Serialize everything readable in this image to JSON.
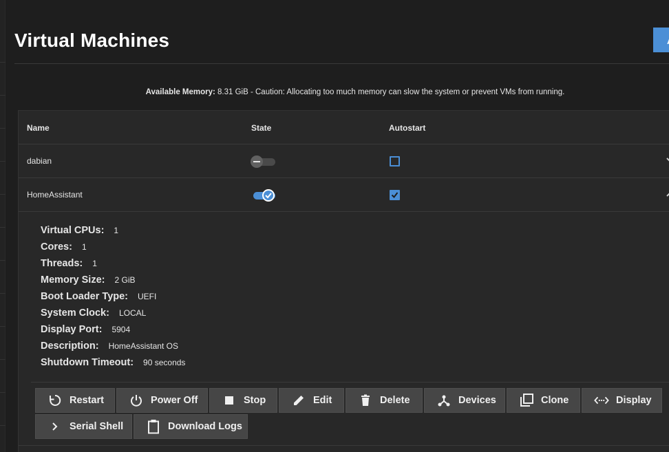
{
  "page": {
    "title": "Virtual Machines",
    "add_button_label": "A"
  },
  "memory_note": {
    "label": "Available Memory:",
    "text": " 8.31 GiB - Caution: Allocating too much memory can slow the system or prevent VMs from running."
  },
  "table": {
    "columns": [
      "Name",
      "State",
      "Autostart"
    ],
    "rows": [
      {
        "name": "dabian",
        "state_on": false,
        "autostart": false
      },
      {
        "name": "HomeAssistant",
        "state_on": true,
        "autostart": true
      }
    ]
  },
  "details": [
    {
      "label": "Virtual CPUs:",
      "value": "1"
    },
    {
      "label": "Cores:",
      "value": "1"
    },
    {
      "label": "Threads:",
      "value": "1"
    },
    {
      "label": "Memory Size:",
      "value": "2 GiB"
    },
    {
      "label": "Boot Loader Type:",
      "value": "UEFI"
    },
    {
      "label": "System Clock:",
      "value": "LOCAL"
    },
    {
      "label": "Display Port:",
      "value": "5904"
    },
    {
      "label": "Description:",
      "value": "HomeAssistant OS"
    },
    {
      "label": "Shutdown Timeout:",
      "value": "90 seconds"
    }
  ],
  "actions": [
    {
      "label": "Restart",
      "icon": "restart-icon"
    },
    {
      "label": "Power Off",
      "icon": "power-icon"
    },
    {
      "label": "Stop",
      "icon": "stop-icon"
    },
    {
      "label": "Edit",
      "icon": "pencil-icon"
    },
    {
      "label": "Delete",
      "icon": "trash-icon"
    },
    {
      "label": "Devices",
      "icon": "devices-icon"
    },
    {
      "label": "Clone",
      "icon": "clone-icon"
    },
    {
      "label": "Display",
      "icon": "code-arrows-icon"
    },
    {
      "label": "Serial Shell",
      "icon": "chevron-right-icon"
    },
    {
      "label": "Download Logs",
      "icon": "clipboard-icon"
    }
  ],
  "colors": {
    "accent": "#4b8fd6",
    "background": "#1e1e1e",
    "card": "#282828",
    "button": "#464646"
  }
}
